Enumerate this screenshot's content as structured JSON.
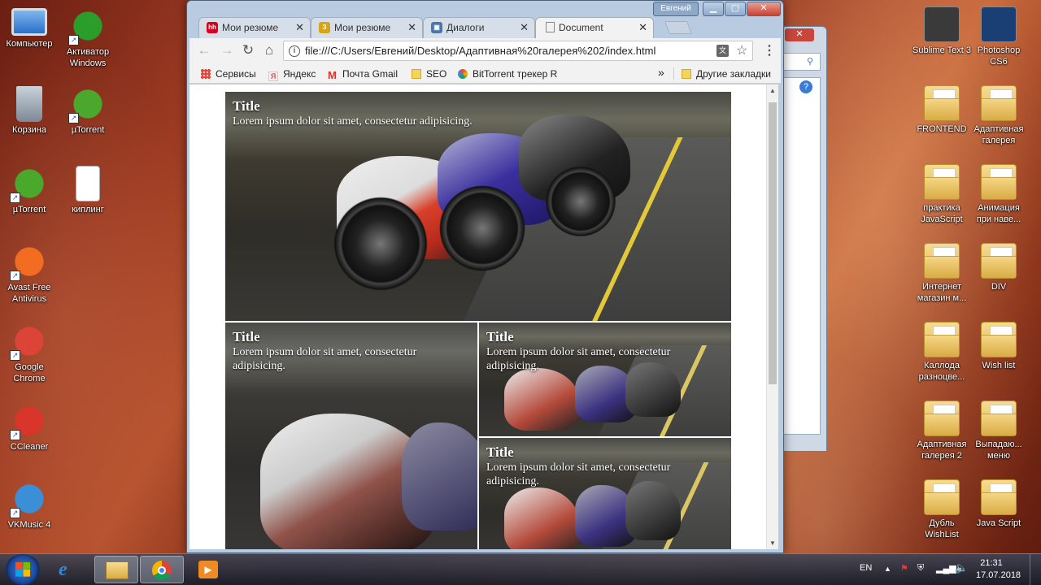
{
  "desktop_left": [
    {
      "label": "Компьютер",
      "name": "computer-icon",
      "color": "#3b7fd4"
    },
    {
      "label": "Активатор Windows",
      "name": "activator-icon",
      "color": "#2a9d2a"
    },
    {
      "label": "Корзина",
      "name": "recycle-bin-icon",
      "color": "#9aa4ad"
    },
    {
      "label": "µTorrent",
      "name": "utorrent-icon",
      "color": "#4aa82c"
    },
    {
      "label": "µTorrent",
      "name": "utorrent-shortcut-icon",
      "color": "#4aa82c"
    },
    {
      "label": "киплинг",
      "name": "text-file-icon",
      "color": "#ffffff"
    },
    {
      "label": "Avast Free Antivirus",
      "name": "avast-icon",
      "color": "#f26d21"
    },
    {
      "label": "Google Chrome",
      "name": "chrome-icon",
      "color": "#db4437"
    },
    {
      "label": "CCleaner",
      "name": "ccleaner-icon",
      "color": "#d9352a"
    },
    {
      "label": "VKMusic 4",
      "name": "vkmusic-icon",
      "color": "#3a8fd6"
    }
  ],
  "desktop_right": [
    {
      "label": "Sublime Text 3",
      "name": "sublime-icon",
      "kind": "app",
      "color": "#3a3a3a"
    },
    {
      "label": "Photoshop CS6",
      "name": "photoshop-icon",
      "kind": "app",
      "color": "#1a3f75"
    },
    {
      "label": "FRONTEND",
      "name": "folder-icon",
      "kind": "folder"
    },
    {
      "label": "Адаптивная галерея",
      "name": "folder-icon",
      "kind": "folder"
    },
    {
      "label": "практика JavaScript",
      "name": "folder-icon",
      "kind": "folder"
    },
    {
      "label": "Анимация при наве...",
      "name": "folder-icon",
      "kind": "folder"
    },
    {
      "label": "Интернет магазин м...",
      "name": "folder-icon",
      "kind": "folder"
    },
    {
      "label": "DIV",
      "name": "folder-icon",
      "kind": "folder"
    },
    {
      "label": "Каллода разноцве...",
      "name": "folder-icon",
      "kind": "folder"
    },
    {
      "label": "Wish list",
      "name": "folder-icon",
      "kind": "folder"
    },
    {
      "label": "Адаптивная галерея 2",
      "name": "folder-icon",
      "kind": "folder"
    },
    {
      "label": "Выпадаю... меню",
      "name": "folder-icon",
      "kind": "folder"
    },
    {
      "label": "Дубль WishList",
      "name": "folder-icon",
      "kind": "folder"
    },
    {
      "label": "Java Script",
      "name": "folder-icon",
      "kind": "folder"
    }
  ],
  "browser": {
    "user": "Евгений",
    "tabs": [
      {
        "label": "Мои резюме",
        "fav": "hh",
        "favcolor": "#d6001c"
      },
      {
        "label": "Мои резюме",
        "fav": "З",
        "favcolor": "#d9a414"
      },
      {
        "label": "Диалоги",
        "fav": "▣",
        "favcolor": "#4a76a8"
      },
      {
        "label": "Document",
        "fav": "",
        "favcolor": "#ffffff"
      }
    ],
    "url": "file:///C:/Users/Евгений/Desktop/Адаптивная%20галерея%202/index.html",
    "bookmarks": [
      {
        "label": "Сервисы",
        "color": "#e04a3a"
      },
      {
        "label": "Яндекс",
        "color": "#ffffff"
      },
      {
        "label": "Почта Gmail",
        "color": "#d93025"
      },
      {
        "label": "SEO",
        "color": "#f4d35e"
      },
      {
        "label": "BitTorrent трекер R",
        "color": "#6aa84f"
      }
    ],
    "more": "»",
    "other_bookmarks": "Другие закладки"
  },
  "gallery": [
    {
      "title": "Title",
      "text": "Lorem ipsum dolor sit amet, consectetur adipisicing."
    },
    {
      "title": "Title",
      "text": "Lorem ipsum dolor sit amet, consectetur adipisicing."
    },
    {
      "title": "Title",
      "text": "Lorem ipsum dolor sit amet, consectetur adipisicing."
    },
    {
      "title": "Title",
      "text": "Lorem ipsum dolor sit amet, consectetur adipisicing."
    }
  ],
  "tray": {
    "lang": "EN",
    "time": "21:31",
    "date": "17.07.2018"
  }
}
